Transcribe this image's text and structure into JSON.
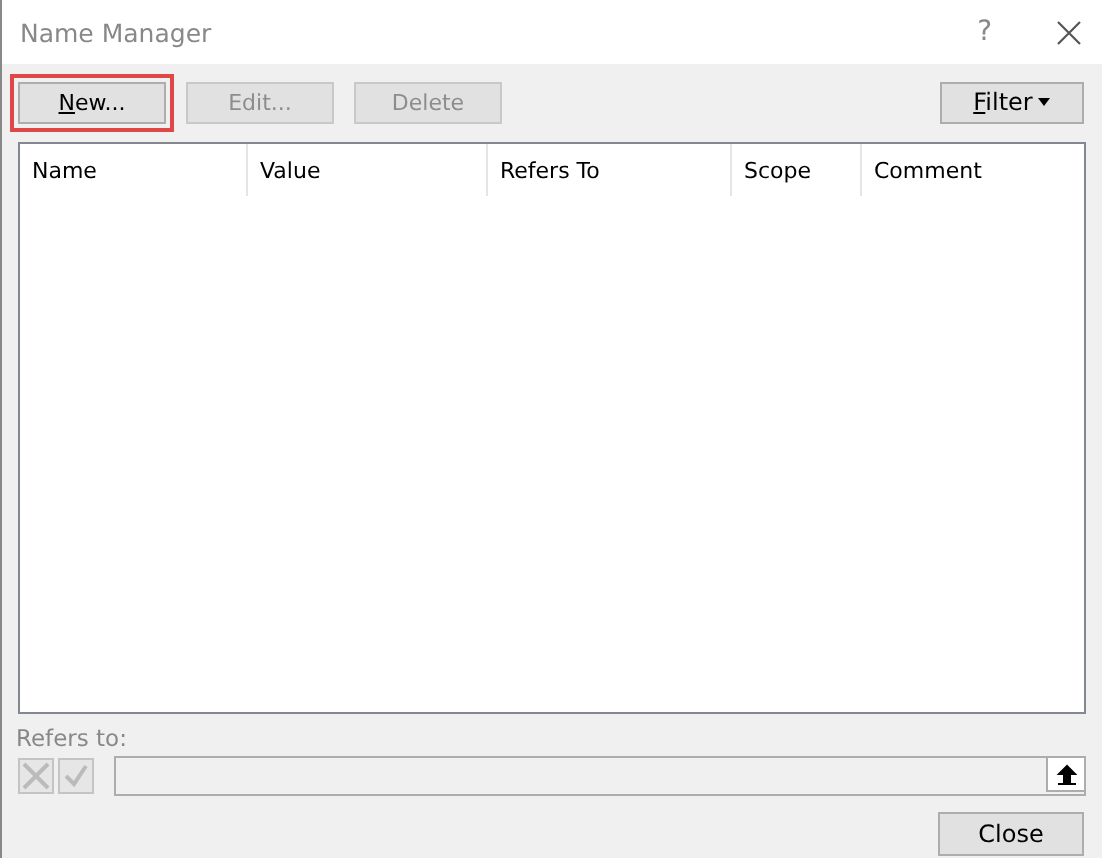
{
  "window": {
    "title": "Name Manager",
    "help": "?"
  },
  "toolbar": [
    {
      "label": "New...",
      "disabled": false,
      "highlighted": true
    },
    {
      "label": "Edit...",
      "disabled": true,
      "highlighted": false
    },
    {
      "label": "Delete",
      "disabled": true,
      "highlighted": false
    }
  ],
  "filter": {
    "label": "Filter"
  },
  "table": {
    "columns": [
      "Name",
      "Value",
      "Refers To",
      "Scope",
      "Comment"
    ]
  },
  "refers_to": {
    "label": "Refers to:"
  },
  "buttons": [
    "Close"
  ]
}
